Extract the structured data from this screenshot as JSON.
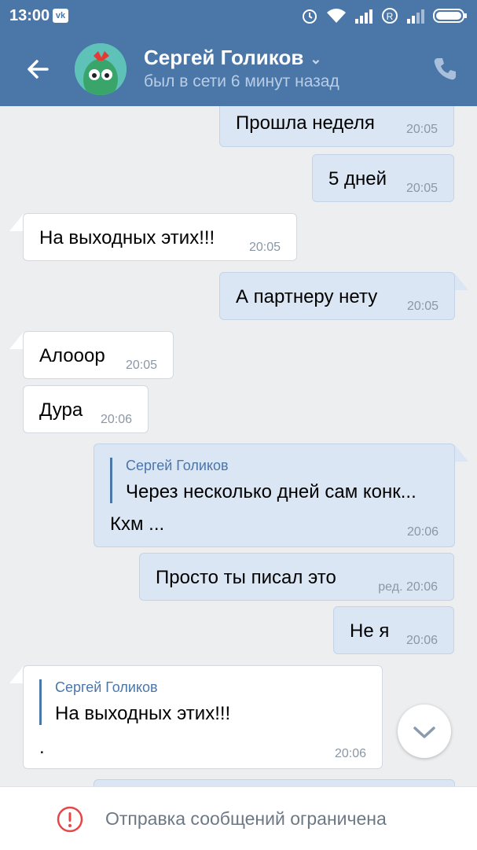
{
  "status_bar": {
    "time": "13:00"
  },
  "header": {
    "name": "Сергей Голиков",
    "status": "был в сети 6 минут назад"
  },
  "messages": [
    {
      "text": "Прошла неделя",
      "time": "20:05"
    },
    {
      "text": "5 дней",
      "time": "20:05"
    },
    {
      "text": "На выходных этих!!!",
      "time": "20:05"
    },
    {
      "text": "А партнеру нету",
      "time": "20:05"
    },
    {
      "text": "Алооор",
      "time": "20:05"
    },
    {
      "text": "Дура",
      "time": "20:06"
    },
    {
      "reply_name": "Сергей Голиков",
      "reply_text": "Через несколько дней сам конк...",
      "text": "Кхм ...",
      "time": "20:06"
    },
    {
      "text": "Просто ты писал это",
      "time": "ред. 20:06"
    },
    {
      "text": "Не я",
      "time": "20:06"
    },
    {
      "reply_name": "Сергей Голиков",
      "reply_text": "На выходных этих!!!",
      "text": ".",
      "time": "20:06"
    }
  ],
  "bottom_bar": {
    "text": "Отправка сообщений ограничена"
  },
  "colors": {
    "header": "#4a76a8",
    "outgoing": "#dbe6f4",
    "incoming": "#ffffff",
    "background": "#edeef0"
  }
}
